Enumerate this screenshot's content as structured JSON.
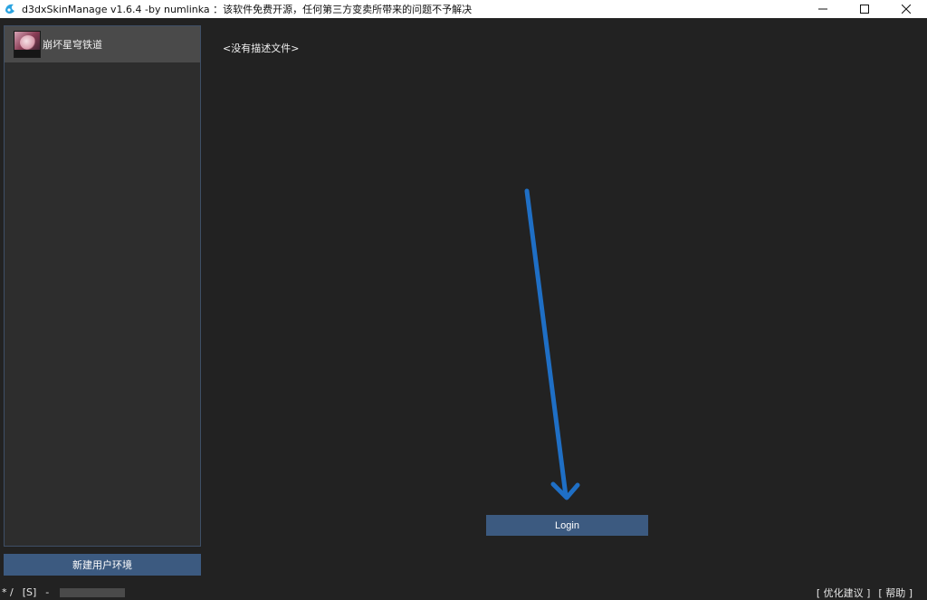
{
  "window": {
    "title": "d3dxSkinManage v1.6.4 -by numlinka ：该软件免费开源，任何第三方变卖所带来的问题不予解决",
    "controls": {
      "minimize": "minimize-icon",
      "maximize": "maximize-icon",
      "close": "close-icon"
    }
  },
  "sidebar": {
    "items": [
      {
        "label": "崩坏星穹铁道",
        "icon": "game-avatar"
      }
    ],
    "new_env_label": "新建用户环境"
  },
  "main": {
    "description": "<没有描述文件>",
    "login_label": "Login"
  },
  "statusbar": {
    "left": [
      "* /",
      "[S]",
      "-"
    ],
    "right": [
      "[ 优化建议 ]",
      "[ 帮助 ]"
    ]
  },
  "colors": {
    "background": "#222222",
    "panel": "#2d2d2d",
    "accent": "#3c5a80",
    "arrow": "#1f6fc5"
  }
}
